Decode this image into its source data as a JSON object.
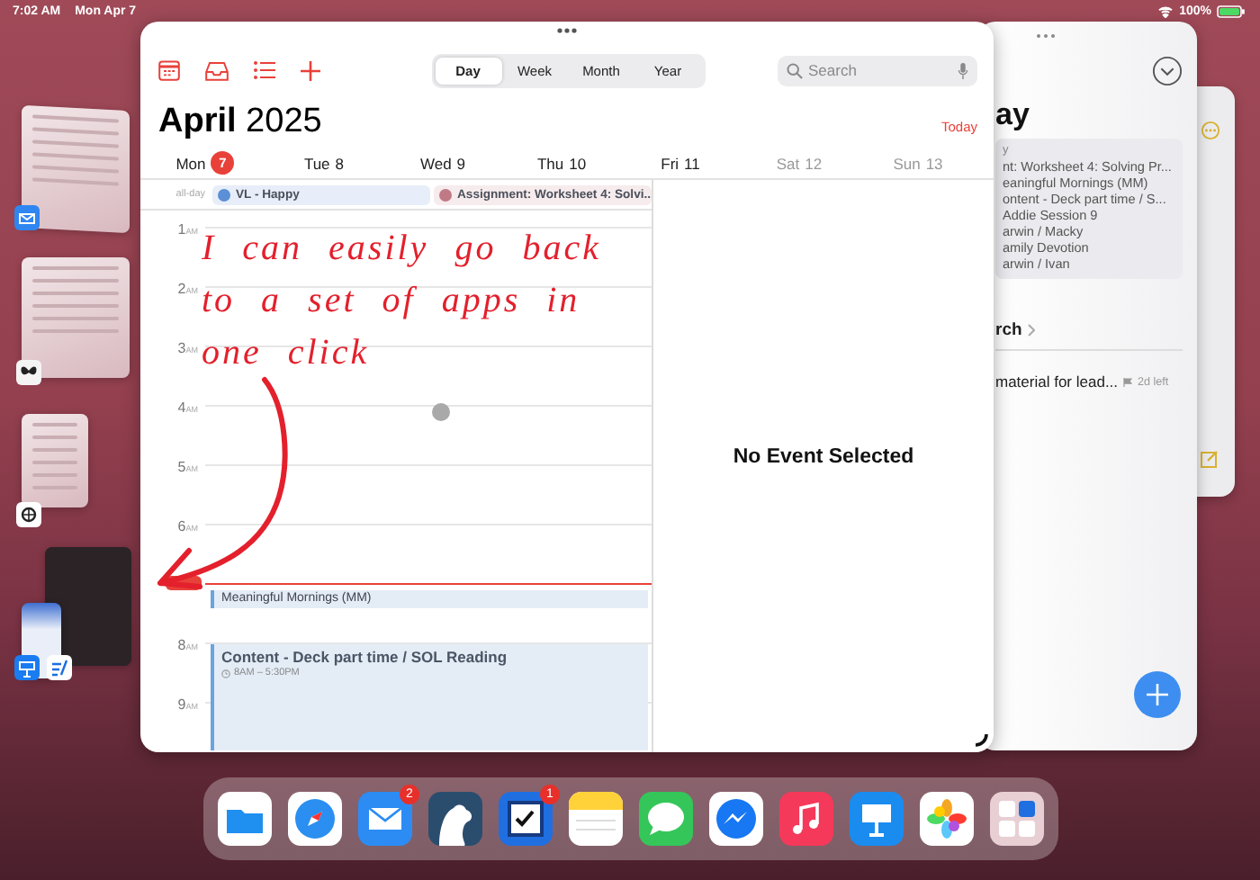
{
  "status_bar": {
    "time": "7:02 AM",
    "date": "Mon Apr 7",
    "battery": "100%"
  },
  "annotation": {
    "text": "I can easily go back to a set of apps in one click"
  },
  "calendar_window": {
    "view_tabs": [
      {
        "label": "Day",
        "selected": true
      },
      {
        "label": "Week",
        "selected": false
      },
      {
        "label": "Month",
        "selected": false
      },
      {
        "label": "Year",
        "selected": false
      }
    ],
    "search": {
      "placeholder": "Search"
    },
    "title": "**April** 2025",
    "today_button": "Today",
    "days": [
      {
        "weekday": "Mon",
        "day": "7",
        "today": true
      },
      {
        "weekday": "Tue",
        "day": "8",
        "today": false
      },
      {
        "weekday": "Wed",
        "day": "9",
        "today": false
      },
      {
        "weekday": "Thu",
        "day": "10",
        "today": false
      },
      {
        "weekday": "Fri",
        "day": "11",
        "today": false
      },
      {
        "weekday": "Sat",
        "day": "12",
        "today": false
      },
      {
        "weekday": "Sun",
        "day": "13",
        "today": false
      }
    ],
    "all_day_label": "all-day",
    "all_day_events": [
      {
        "title": "VL - Happy",
        "color": "#5b8fd6"
      },
      {
        "title": "Assignment: Worksheet 4: Solvi...",
        "color": "#c07a86"
      }
    ],
    "timeline": [
      {
        "hour": "1",
        "period": "AM",
        "current_time": false
      },
      {
        "hour": "2",
        "period": "AM",
        "current_time": false
      },
      {
        "hour": "3",
        "period": "AM",
        "current_time": false
      },
      {
        "hour": "4",
        "period": "AM",
        "current_time": false
      },
      {
        "hour": "5",
        "period": "AM",
        "current_time": false
      },
      {
        "hour": "6",
        "period": "AM",
        "current_time": false
      },
      {
        "current_time": true
      },
      {
        "hour": "8",
        "period": "AM",
        "current_time": false
      },
      {
        "hour": "9",
        "period": "AM",
        "current_time": false
      }
    ],
    "events": [
      {
        "title": "Meaningful Mornings (MM)"
      },
      {
        "title": "Content - Deck part time / SOL Reading",
        "time": "8AM – 5:30PM"
      }
    ],
    "detail_message": "No Event Selected"
  },
  "side_window": {
    "title": "ay",
    "summary_lines": [
      "y",
      "nt: Worksheet 4: Solving Pr...",
      "eaningful Mornings (MM)",
      "ontent - Deck part time / S...",
      "Addie Session 9",
      "arwin / Macky",
      "amily Devotion",
      "arwin / Ivan"
    ],
    "section": "rch",
    "reminder": {
      "title": "material for lead...",
      "due": "2d left"
    }
  },
  "dock": [
    {
      "kind": "folder"
    },
    {
      "kind": "compass"
    },
    {
      "kind": "envelope",
      "badge": "2"
    },
    {
      "kind": "bear"
    },
    {
      "kind": "checkbox",
      "badge": "1"
    },
    {
      "kind": "notepad"
    },
    {
      "kind": "bubble"
    },
    {
      "kind": "bolt-bubble"
    },
    {
      "kind": "note"
    },
    {
      "kind": "podium"
    },
    {
      "kind": "flower"
    },
    {
      "kind": "group"
    }
  ]
}
